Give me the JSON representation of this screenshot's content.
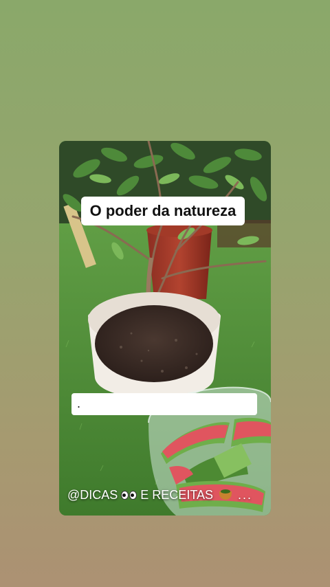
{
  "story": {
    "title_caption": "O poder da natureza",
    "text_caption": ".",
    "watermark": {
      "prefix": "@DICAS",
      "eyes_icon": "eyes-emoji",
      "suffix": "E RECEITAS",
      "bowl_icon": "salad-bowl-emoji",
      "trailing": "..."
    }
  },
  "colors": {
    "background_top": "#8aa86a",
    "background_bottom": "#ac9173",
    "grass": "#4f8a3a",
    "pot": "#f2ede6",
    "soil": "#3b2c25",
    "watermelon_rind": "#6fae4a",
    "watermelon_flesh": "#e0555f"
  }
}
